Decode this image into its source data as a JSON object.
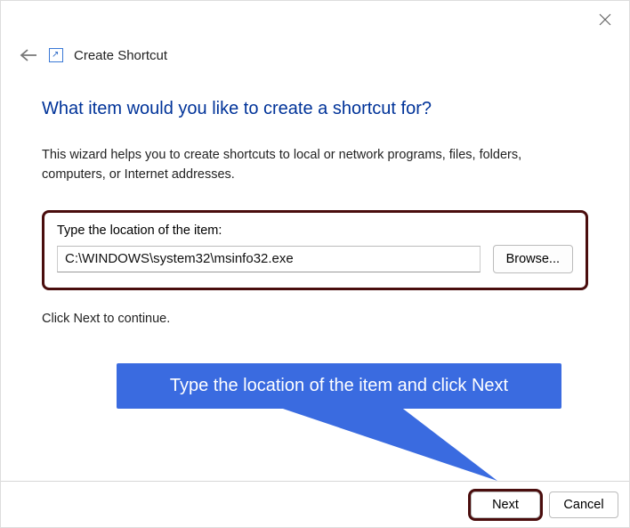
{
  "header": {
    "title": "Create Shortcut"
  },
  "main": {
    "question": "What item would you like to create a shortcut for?",
    "description": "This wizard helps you to create shortcuts to local or network programs, files, folders, computers, or Internet addresses.",
    "input_label": "Type the location of the item:",
    "input_value": "C:\\WINDOWS\\system32\\msinfo32.exe",
    "browse_label": "Browse...",
    "continue_text": "Click Next to continue."
  },
  "callout": {
    "text": "Type the location of the item and click Next"
  },
  "footer": {
    "next_label": "Next",
    "cancel_label": "Cancel"
  }
}
